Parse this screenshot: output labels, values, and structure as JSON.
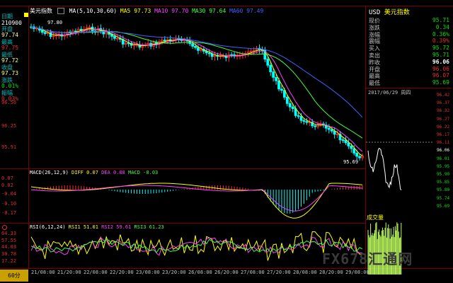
{
  "header": {
    "title": "美元指数",
    "ma_params": "MA(5,10,30,60)",
    "ma5": "MA5 97.73",
    "ma10": "MA10 97.70",
    "ma30": "MA30 97.64",
    "ma60": "MA60 97.49"
  },
  "left_info": {
    "date_label": "日期",
    "date_value": "210900",
    "open_label": "开盘",
    "open_value": "97.74",
    "high_label": "最高",
    "high_value": "97.75",
    "low_label": "最低",
    "low_value": "97.72",
    "close_label": "收盘",
    "close_value": "97.73",
    "change_label": "涨跌",
    "change_value": "0.01%",
    "amp_label": "振幅",
    "amp_value": "0.03%"
  },
  "price_axis": [
    "96.56",
    "96.25",
    "95.91"
  ],
  "peak_label": "97.80",
  "low_label_chart": "95.69",
  "macd": {
    "legend": "MACD(26,12,9)",
    "diff": "DIFF 0.07",
    "dea": "DEA 0.08",
    "macd": "MACD -0.03",
    "ticks": [
      "0.07",
      "0.02",
      "-0.04",
      "-0.10",
      "-0.17"
    ]
  },
  "rsi": {
    "legend": "RSI(6,12,24)",
    "rsi1": "RSI1 51.01",
    "rsi2": "RSI2 59.61",
    "rsi3": "RSI3 61.23",
    "ticks": [
      "64.33",
      "57.55",
      "44.03",
      "30.78",
      "17.22"
    ]
  },
  "x_labels": [
    "21/08:00",
    "21/20:00",
    "22/08:00",
    "22/20:00",
    "23/08:00",
    "23/20:00",
    "26/08:00",
    "26/20:00",
    "27/08:00",
    "27/20:00",
    "28/08:00",
    "28/20:00",
    "29/08:00"
  ],
  "period_button": "60分",
  "quote": {
    "symbol": "USD",
    "name": "美元指数",
    "rows": [
      {
        "k": "现价",
        "v": "95.71",
        "c": "#00e000"
      },
      {
        "k": "涨跌",
        "v": "0.34",
        "c": "#00e000"
      },
      {
        "k": "涨幅",
        "v": "0.36%",
        "c": "#00e000"
      },
      {
        "k": "震幅",
        "v": "0.39%",
        "c": "#e03030"
      },
      {
        "k": "买入",
        "v": "95.72",
        "c": "#00e000"
      },
      {
        "k": "卖出",
        "v": "95.71",
        "c": "#00e000"
      },
      {
        "k": "昨收",
        "v": "96.06",
        "c": "#ffffff"
      },
      {
        "k": "开盘",
        "v": "96.06",
        "c": "#e03030"
      },
      {
        "k": "最高",
        "v": "96.07",
        "c": "#e03030"
      },
      {
        "k": "最低",
        "v": "95.69",
        "c": "#00e000"
      }
    ],
    "date": "2017/06/29 周四",
    "tick_axis": [
      "96.42",
      "96.37",
      "96.32",
      "96.27",
      "96.22",
      "96.17",
      "96.11",
      "96.06",
      "96.01",
      "95.95",
      "95.90",
      "95.85",
      "95.80",
      "95.74",
      "95.69"
    ],
    "volume_label": "成交量"
  },
  "watermark": "FX678汇通网"
}
